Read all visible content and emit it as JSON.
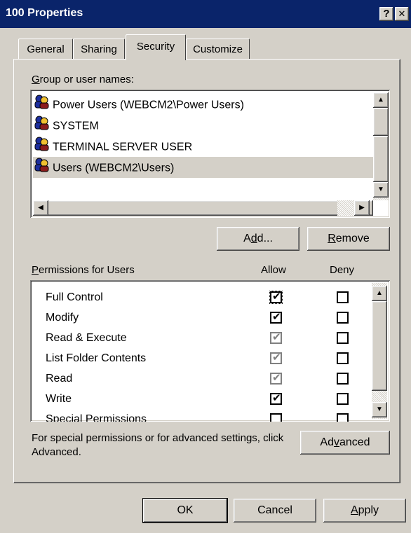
{
  "window": {
    "title": "100 Properties",
    "help_glyph": "?",
    "close_glyph": "✕"
  },
  "tabs": [
    {
      "label": "General"
    },
    {
      "label": "Sharing"
    },
    {
      "label": "Security"
    },
    {
      "label": "Customize"
    }
  ],
  "groups": {
    "label": "Group or user names:",
    "items": [
      {
        "name": "Power Users (WEBCM2\\Power Users)",
        "icon": "users-group-icon"
      },
      {
        "name": "SYSTEM",
        "icon": "users-group-icon"
      },
      {
        "name": "TERMINAL SERVER USER",
        "icon": "users-group-icon"
      },
      {
        "name": "Users (WEBCM2\\Users)",
        "icon": "users-group-icon",
        "selected": true
      }
    ],
    "add_label": "Add...",
    "remove_label": "Remove"
  },
  "permissions": {
    "label": "Permissions for Users",
    "allow_header": "Allow",
    "deny_header": "Deny",
    "rows": [
      {
        "name": "Full Control",
        "allow": "checked",
        "deny": "unchecked"
      },
      {
        "name": "Modify",
        "allow": "checked",
        "deny": "unchecked"
      },
      {
        "name": "Read & Execute",
        "allow": "checked-disabled",
        "deny": "unchecked"
      },
      {
        "name": "List Folder Contents",
        "allow": "checked-disabled",
        "deny": "unchecked"
      },
      {
        "name": "Read",
        "allow": "checked-disabled",
        "deny": "unchecked"
      },
      {
        "name": "Write",
        "allow": "checked",
        "deny": "unchecked"
      },
      {
        "name": "Special Permissions",
        "allow": "unchecked",
        "deny": "unchecked"
      }
    ]
  },
  "advanced": {
    "note": "For special permissions or for advanced settings, click Advanced.",
    "button_label": "Advanced"
  },
  "footer": {
    "ok_label": "OK",
    "cancel_label": "Cancel",
    "apply_label": "Apply"
  },
  "colors": {
    "titlebar": "#0a246a",
    "face": "#d4d0c8"
  }
}
